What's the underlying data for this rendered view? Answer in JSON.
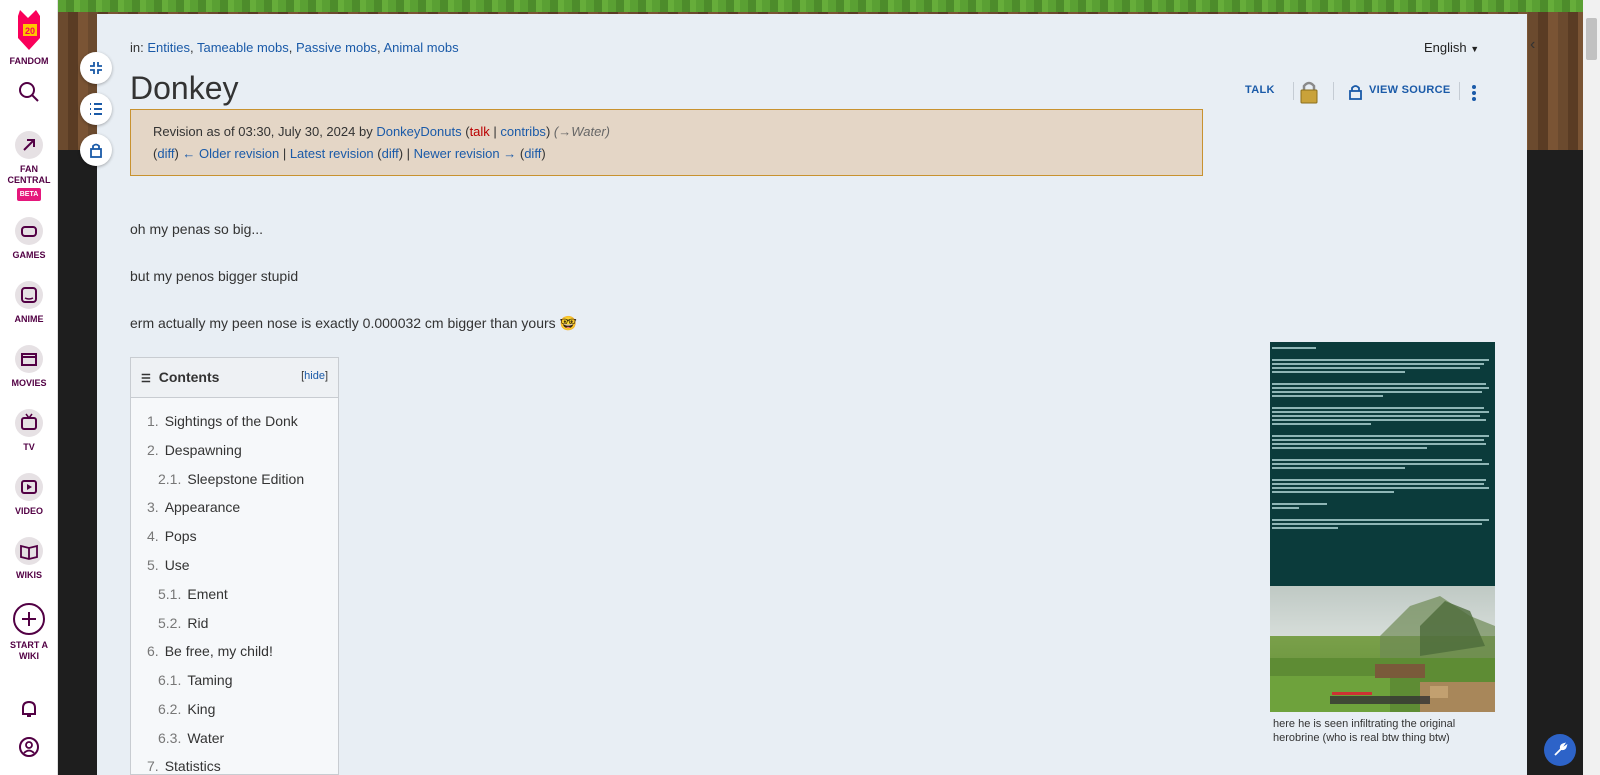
{
  "global_nav": {
    "fandom": "FANDOM",
    "fan_central": "FAN CENTRAL",
    "beta": "BETA",
    "games": "GAMES",
    "anime": "ANIME",
    "movies": "MOVIES",
    "tv": "TV",
    "video": "VIDEO",
    "wikis": "WIKIS",
    "start_a_wiki": "START A WIKI",
    "logo_badge": "20"
  },
  "header": {
    "in_label": "in:",
    "categories": [
      "Entities",
      "Tameable mobs",
      "Passive mobs",
      "Animal mobs"
    ],
    "language": "English",
    "title": "Donkey",
    "talk": "TALK",
    "view_source": "VIEW SOURCE"
  },
  "revision": {
    "line1_prefix": "Revision as of 03:30, July 30, 2024 by",
    "user": "DonkeyDonuts",
    "talk": "talk",
    "contribs": "contribs",
    "summary": "(→Water)",
    "diff": "diff",
    "older": "← Older revision",
    "latest": "Latest revision",
    "newer": "Newer revision →"
  },
  "content": {
    "p1": "oh my penas so big...",
    "p2": "but my penos bigger stupid",
    "p3": "erm actually my peen nose is exactly 0.000032 cm bigger than yours 🤓"
  },
  "toc": {
    "title": "Contents",
    "hide": "hide",
    "items": [
      {
        "num": "1.",
        "label": "Sightings of the Donk"
      },
      {
        "num": "2.",
        "label": "Despawning"
      },
      {
        "num": "2.1.",
        "label": "Sleepstone Edition"
      },
      {
        "num": "3.",
        "label": "Appearance"
      },
      {
        "num": "4.",
        "label": "Pops"
      },
      {
        "num": "5.",
        "label": "Use"
      },
      {
        "num": "5.1.",
        "label": "Ement"
      },
      {
        "num": "5.2.",
        "label": "Rid"
      },
      {
        "num": "6.",
        "label": "Be free, my child!"
      },
      {
        "num": "6.1.",
        "label": "Taming"
      },
      {
        "num": "6.2.",
        "label": "King"
      },
      {
        "num": "6.3.",
        "label": "Water"
      },
      {
        "num": "7.",
        "label": "Statistics"
      }
    ]
  },
  "figure": {
    "caption": "here he is seen infiltrating the original herobrine (who is real btw thing btw)"
  }
}
